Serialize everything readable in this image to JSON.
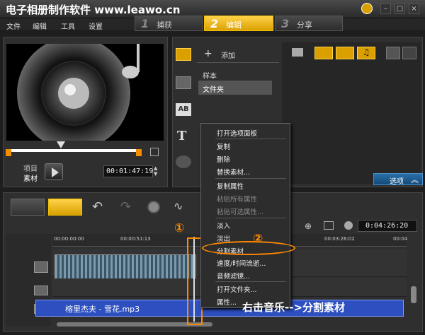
{
  "window": {
    "title": "电子相册制作软件 www.leawo.cn"
  },
  "menu": [
    "文件",
    "编辑",
    "工具",
    "设置"
  ],
  "steps": [
    {
      "num": "1",
      "label": "捕获"
    },
    {
      "num": "2",
      "label": "编辑"
    },
    {
      "num": "3",
      "label": "分享"
    }
  ],
  "preview": {
    "mode_project": "项目",
    "mode_clip": "素材",
    "timecode": "00:01:47:19"
  },
  "library": {
    "add_label": "添加",
    "items": [
      "样本",
      "文件夹"
    ],
    "options_label": "选项"
  },
  "context_menu": {
    "items": [
      {
        "label": "打开选项面板",
        "disabled": false
      },
      {
        "label": "复制",
        "disabled": false
      },
      {
        "label": "删除",
        "disabled": false
      },
      {
        "label": "替换素材...",
        "disabled": false
      },
      {
        "label": "复制属性",
        "disabled": false
      },
      {
        "label": "粘贴所有属性",
        "disabled": true
      },
      {
        "label": "粘贴可选属性...",
        "disabled": true
      },
      {
        "label": "淡入",
        "disabled": false
      },
      {
        "label": "淡出",
        "disabled": false
      },
      {
        "label": "分割素材",
        "disabled": false
      },
      {
        "label": "速度/时间流逝...",
        "disabled": false
      },
      {
        "label": "音频滤镜...",
        "disabled": false
      },
      {
        "label": "打开文件夹...",
        "disabled": false
      },
      {
        "label": "属性...",
        "disabled": false
      }
    ]
  },
  "timeline": {
    "ruler": [
      "00:00:00:00",
      "00:00:51:13",
      "00:03:26:02",
      "00:04"
    ],
    "total_time": "0:04:26:20",
    "audio_clip_name": "榕里杰夫 - 雪花.mp3"
  },
  "annotations": {
    "step1": "①",
    "step2": "②",
    "caption": "右击音乐-->分割素材"
  },
  "colors": {
    "accent": "#f2c200",
    "annotation": "#ff8a00",
    "audio_clip": "#2d4fbf"
  }
}
